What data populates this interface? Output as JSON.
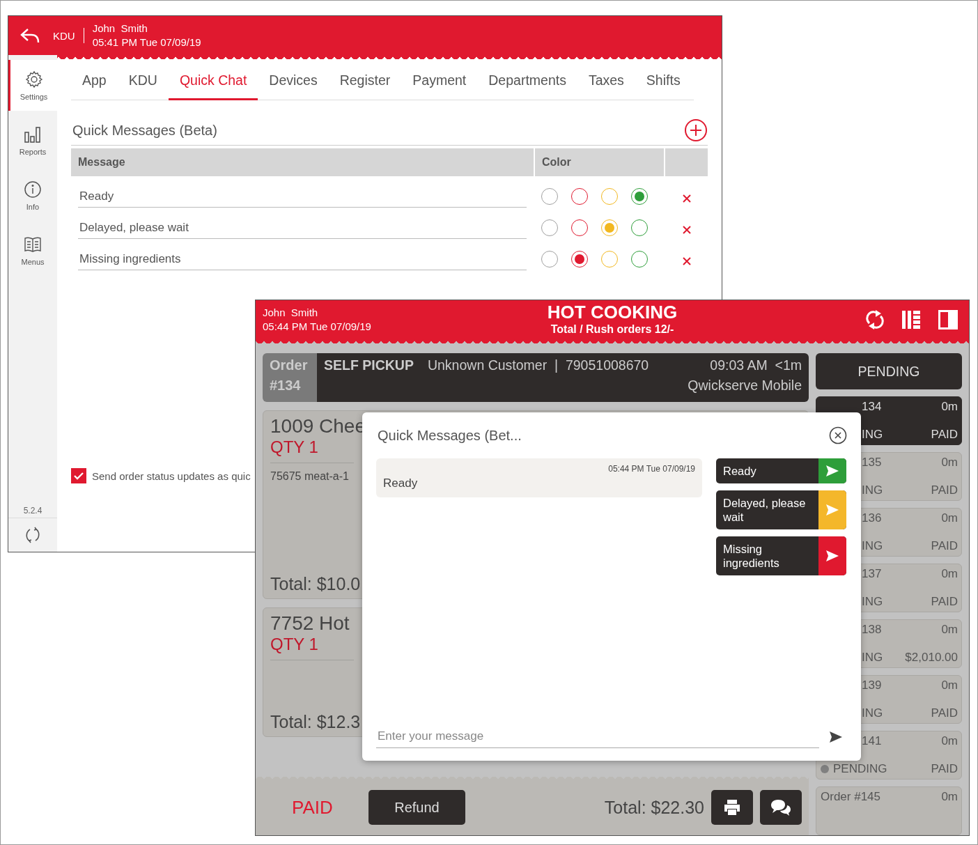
{
  "settings_window": {
    "header": {
      "app": "KDU",
      "user": "John  Smith",
      "datetime": "05:41 PM Tue 07/09/19"
    },
    "sidebar": {
      "items": [
        {
          "label": "Settings",
          "selected": true
        },
        {
          "label": "Reports",
          "selected": false
        },
        {
          "label": "Info",
          "selected": false
        },
        {
          "label": "Menus",
          "selected": false
        }
      ],
      "version": "5.2.4"
    },
    "tabs": [
      {
        "label": "App",
        "selected": false
      },
      {
        "label": "KDU",
        "selected": false
      },
      {
        "label": "Quick Chat",
        "selected": true
      },
      {
        "label": "Devices",
        "selected": false
      },
      {
        "label": "Register",
        "selected": false
      },
      {
        "label": "Payment",
        "selected": false
      },
      {
        "label": "Departments",
        "selected": false
      },
      {
        "label": "Taxes",
        "selected": false
      },
      {
        "label": "Shifts",
        "selected": false
      }
    ],
    "section_title": "Quick Messages (Beta)",
    "table": {
      "columns": [
        "Message",
        "Color"
      ],
      "rows": [
        {
          "message": "Ready",
          "colors": [
            {
              "color": "#a0a0a0",
              "selected": false
            },
            {
              "color": "#e0192f",
              "selected": false
            },
            {
              "color": "#f2b820",
              "selected": false
            },
            {
              "color": "#2e9e3a",
              "selected": true
            }
          ]
        },
        {
          "message": "Delayed, please wait",
          "colors": [
            {
              "color": "#a0a0a0",
              "selected": false
            },
            {
              "color": "#e0192f",
              "selected": false
            },
            {
              "color": "#f2b820",
              "selected": true
            },
            {
              "color": "#2e9e3a",
              "selected": false
            }
          ]
        },
        {
          "message": "Missing ingredients",
          "colors": [
            {
              "color": "#a0a0a0",
              "selected": false
            },
            {
              "color": "#e0192f",
              "selected": true
            },
            {
              "color": "#f2b820",
              "selected": false
            },
            {
              "color": "#2e9e3a",
              "selected": false
            }
          ]
        }
      ]
    },
    "status_option": {
      "label": "Send order status updates as quic",
      "checked": true
    }
  },
  "kitchen_window": {
    "header": {
      "user": "John  Smith",
      "datetime": "05:44 PM Tue 07/09/19",
      "title": "HOT COOKING",
      "subtitle": "Total / Rush orders 12/-"
    },
    "order": {
      "label": "Order",
      "number": "#134",
      "type": "SELF PICKUP",
      "customer": "Unknown Customer  |  79051008670",
      "time": "09:03 AM  <1m",
      "source": "Qwickserve Mobile"
    },
    "pending_button": "PENDING",
    "items": [
      {
        "name": "1009 Chee",
        "qty": "QTY 1",
        "notes": "75675 meat-a-1",
        "total": "Total: $10.0"
      },
      {
        "name": "7752 Hot",
        "qty": "QTY 1",
        "total": "Total: $12.3"
      }
    ],
    "footer": {
      "status": "PAID",
      "refund": "Refund",
      "total": "Total: $22.30"
    },
    "tickets": [
      {
        "number": "134",
        "age": "0m",
        "status": "ING",
        "payment": "PAID",
        "dot": false,
        "selected": true
      },
      {
        "number": "135",
        "age": "0m",
        "status": "ING",
        "payment": "PAID",
        "dot": false,
        "selected": false
      },
      {
        "number": "136",
        "age": "0m",
        "status": "ING",
        "payment": "PAID",
        "dot": false,
        "selected": false
      },
      {
        "number": "137",
        "age": "0m",
        "status": "ING",
        "payment": "PAID",
        "dot": false,
        "selected": false
      },
      {
        "number": "138",
        "age": "0m",
        "status": "ING",
        "payment": "$2,010.00",
        "dot": false,
        "selected": false
      },
      {
        "number": "139",
        "age": "0m",
        "status": "ING",
        "payment": "PAID",
        "dot": false,
        "selected": false
      },
      {
        "number": "141",
        "age": "0m",
        "status": "PENDING",
        "payment": "PAID",
        "dot": true,
        "selected": false
      },
      {
        "number": "Order #145",
        "age": "0m",
        "selected": false
      }
    ],
    "modal": {
      "title": "Quick Messages (Bet...",
      "messages": [
        {
          "time": "05:44 PM Tue 07/09/19",
          "text": "Ready"
        }
      ],
      "quick_replies": [
        {
          "label": "Ready",
          "color": "#2e9e3a"
        },
        {
          "label": "Delayed, please wait",
          "color": "#f4b72b"
        },
        {
          "label": "Missing ingredients",
          "color": "#e0192f"
        }
      ],
      "input": {
        "placeholder": "Enter your message"
      }
    }
  }
}
